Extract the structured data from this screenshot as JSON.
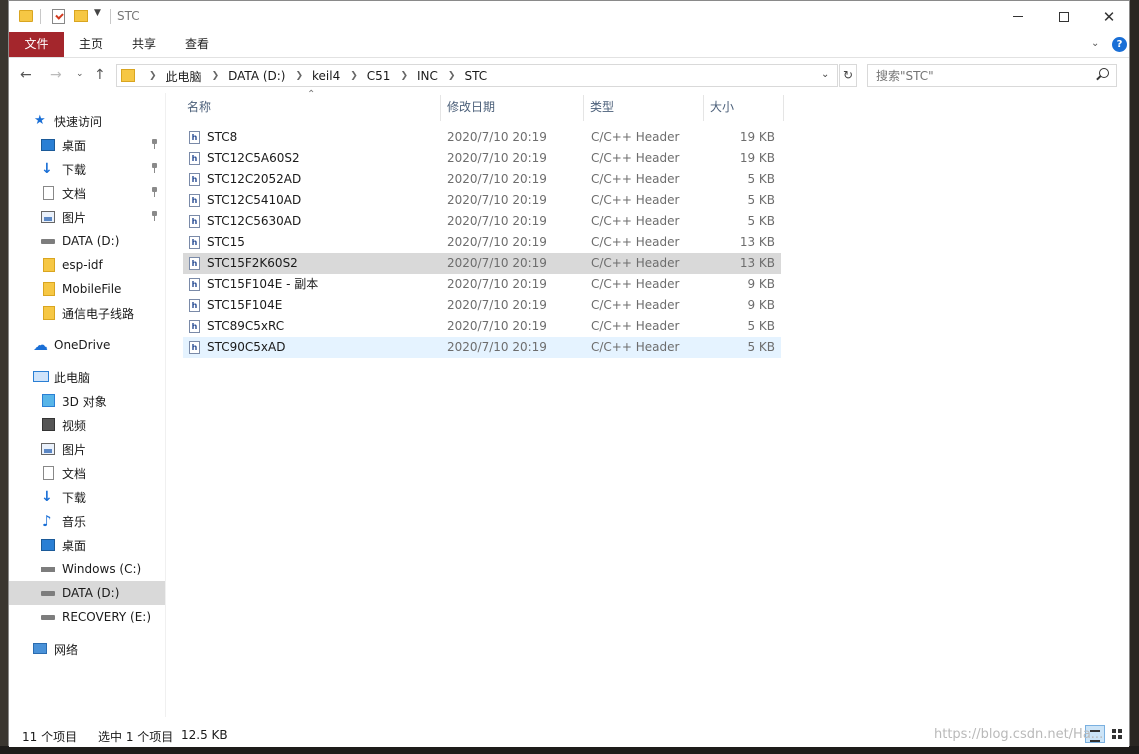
{
  "window": {
    "title": "STC",
    "minimize_symbol": "",
    "close_symbol": "✕"
  },
  "ribbon": {
    "tabs": [
      "文件",
      "主页",
      "共享",
      "查看"
    ]
  },
  "address": {
    "crumbs": [
      "此电脑",
      "DATA (D:)",
      "keil4",
      "C51",
      "INC",
      "STC"
    ]
  },
  "search": {
    "placeholder": "搜索\"STC\""
  },
  "sidebar": {
    "quick_access": "快速访问",
    "quick_items": [
      "桌面",
      "下载",
      "文档",
      "图片",
      "DATA (D:)",
      "esp-idf",
      "MobileFile",
      "通信电子线路"
    ],
    "onedrive": "OneDrive",
    "this_pc": "此电脑",
    "pc_items": [
      "3D 对象",
      "视频",
      "图片",
      "文档",
      "下载",
      "音乐",
      "桌面",
      "Windows (C:)",
      "DATA (D:)",
      "RECOVERY (E:)"
    ],
    "network": "网络"
  },
  "columns": {
    "name": "名称",
    "date": "修改日期",
    "type": "类型",
    "size": "大小"
  },
  "files": [
    {
      "name": "STC8",
      "date": "2020/7/10 20:19",
      "type": "C/C++ Header",
      "size": "19 KB"
    },
    {
      "name": "STC12C5A60S2",
      "date": "2020/7/10 20:19",
      "type": "C/C++ Header",
      "size": "19 KB"
    },
    {
      "name": "STC12C2052AD",
      "date": "2020/7/10 20:19",
      "type": "C/C++ Header",
      "size": "5 KB"
    },
    {
      "name": "STC12C5410AD",
      "date": "2020/7/10 20:19",
      "type": "C/C++ Header",
      "size": "5 KB"
    },
    {
      "name": "STC12C5630AD",
      "date": "2020/7/10 20:19",
      "type": "C/C++ Header",
      "size": "5 KB"
    },
    {
      "name": "STC15",
      "date": "2020/7/10 20:19",
      "type": "C/C++ Header",
      "size": "13 KB"
    },
    {
      "name": "STC15F2K60S2",
      "date": "2020/7/10 20:19",
      "type": "C/C++ Header",
      "size": "13 KB"
    },
    {
      "name": "STC15F104E - 副本",
      "date": "2020/7/10 20:19",
      "type": "C/C++ Header",
      "size": "9 KB"
    },
    {
      "name": "STC15F104E",
      "date": "2020/7/10 20:19",
      "type": "C/C++ Header",
      "size": "9 KB"
    },
    {
      "name": "STC89C5xRC",
      "date": "2020/7/10 20:19",
      "type": "C/C++ Header",
      "size": "5 KB"
    },
    {
      "name": "STC90C5xAD",
      "date": "2020/7/10 20:19",
      "type": "C/C++ Header",
      "size": "5 KB"
    }
  ],
  "file_icon_letter": "h",
  "status": {
    "count": "11 个项目",
    "selected": "选中 1 个项目",
    "size": "12.5 KB"
  },
  "watermark": "https://blog.csdn.net/Ha..."
}
